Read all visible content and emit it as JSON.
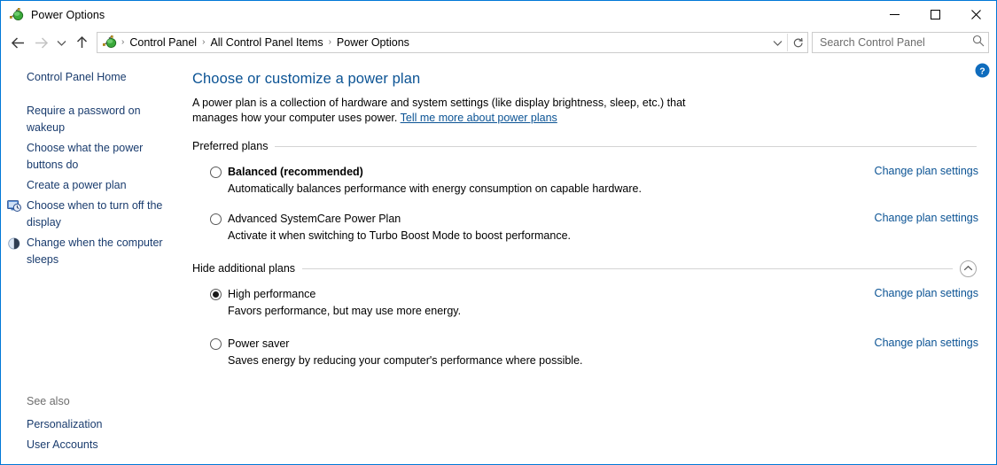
{
  "window": {
    "title": "Power Options",
    "icon": "power-plug-icon",
    "caption": {
      "minimize": "─",
      "maximize": "☐",
      "close": "✕",
      "minimize_name": "minimize-button",
      "maximize_name": "maximize-button",
      "close_name": "close-button"
    }
  },
  "navbar": {
    "back_tooltip": "Back",
    "forward_tooltip": "Forward",
    "recent_tooltip": "Recent locations",
    "up_tooltip": "Up one level",
    "breadcrumbs": [
      {
        "label": "Control Panel"
      },
      {
        "label": "All Control Panel Items"
      },
      {
        "label": "Power Options"
      }
    ],
    "separator": "›",
    "dropdown_label": "⌄",
    "refresh_label": "↻"
  },
  "search": {
    "placeholder": "Search Control Panel",
    "value": "",
    "icon": "search-icon"
  },
  "sidebar": {
    "home_label": "Control Panel Home",
    "links": [
      {
        "label": "Require a password on wakeup",
        "icon": null
      },
      {
        "label": "Choose what the power buttons do",
        "icon": null
      },
      {
        "label": "Create a power plan",
        "icon": null
      },
      {
        "label": "Choose when to turn off the display",
        "icon": "monitor-clock-icon"
      },
      {
        "label": "Change when the computer sleeps",
        "icon": "sleep-moon-icon"
      }
    ],
    "see_also_title": "See also",
    "see_also": [
      {
        "label": "Personalization"
      },
      {
        "label": "User Accounts"
      }
    ]
  },
  "main": {
    "title": "Choose or customize a power plan",
    "description_part1": "A power plan is a collection of hardware and system settings (like display brightness, sleep, etc.) that manages how your computer uses power.",
    "description_link": "Tell me more about power plans",
    "help_icon": "help-question-icon",
    "groups": [
      {
        "label": "Preferred plans",
        "collapsible": false,
        "plans": [
          {
            "name": "Balanced (recommended)",
            "bold": true,
            "selected": false,
            "description": "Automatically balances performance with energy consumption on capable hardware.",
            "change_link": "Change plan settings"
          },
          {
            "name": "Advanced SystemCare Power Plan",
            "bold": false,
            "selected": false,
            "description": "Activate it when switching to Turbo Boost Mode to boost performance.",
            "change_link": "Change plan settings"
          }
        ]
      },
      {
        "label": "Hide additional plans",
        "collapsible": true,
        "collapse_icon": "chevron-up-icon",
        "plans": [
          {
            "name": "High performance",
            "bold": false,
            "selected": true,
            "description": "Favors performance, but may use more energy.",
            "change_link": "Change plan settings"
          },
          {
            "name": "Power saver",
            "bold": false,
            "selected": false,
            "description": "Saves energy by reducing your computer's performance where possible.",
            "change_link": "Change plan settings"
          }
        ]
      }
    ]
  },
  "colors": {
    "accent": "#0078d7",
    "link": "#0b5394",
    "sidebar_link": "#1a3c6e",
    "title_heading": "#0b5394",
    "muted": "#6d6d6d",
    "rule": "#d4d4d4"
  }
}
